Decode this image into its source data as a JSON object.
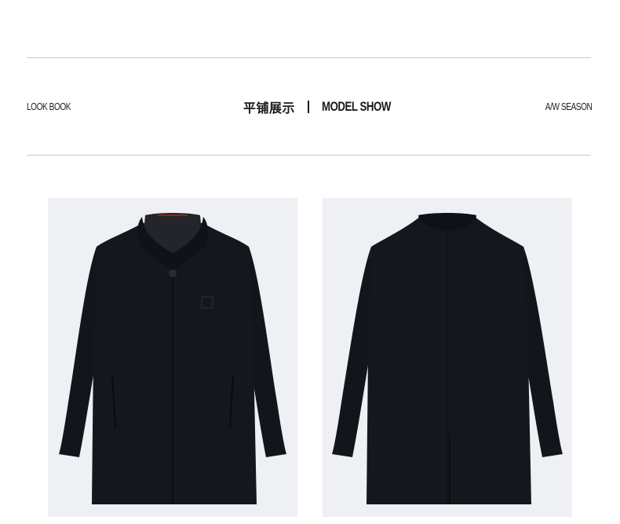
{
  "header": {
    "left_label": "LOOK BOOK",
    "title_cn": "平铺展示",
    "title_en": "MODEL SHOW",
    "right_label": "A/W SEASON"
  },
  "photos": [
    {
      "view": "front",
      "subject": "coat-front-image"
    },
    {
      "view": "back",
      "subject": "coat-back-image"
    }
  ],
  "colors": {
    "coat": "#15171f",
    "photo_background": "#eff0f3",
    "rule": "#c9c9c9",
    "collar_lining_accent": "#7a2a1e"
  }
}
